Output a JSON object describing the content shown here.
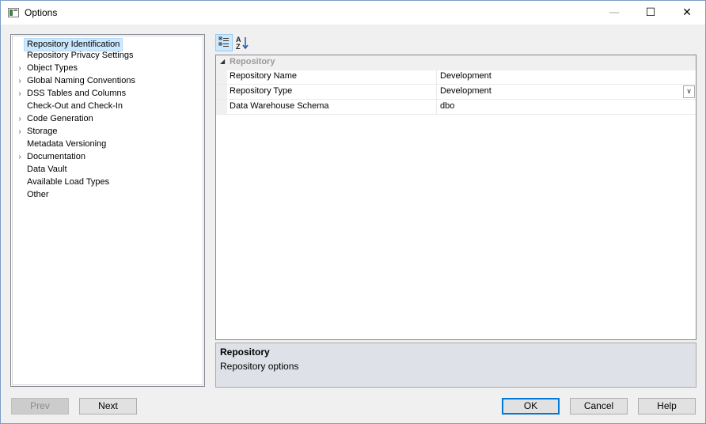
{
  "window": {
    "title": "Options",
    "minimize_glyph": "—",
    "maximize_glyph": "☐",
    "close_glyph": "✕"
  },
  "tree": {
    "items": [
      {
        "label": "Repository Identification",
        "expandable": false,
        "selected": true
      },
      {
        "label": "Repository Privacy Settings",
        "expandable": false
      },
      {
        "label": "Object Types",
        "expandable": true
      },
      {
        "label": "Global Naming Conventions",
        "expandable": true
      },
      {
        "label": "DSS Tables and Columns",
        "expandable": true
      },
      {
        "label": "Check-Out and Check-In",
        "expandable": false
      },
      {
        "label": "Code Generation",
        "expandable": true
      },
      {
        "label": "Storage",
        "expandable": true
      },
      {
        "label": "Metadata Versioning",
        "expandable": false
      },
      {
        "label": "Documentation",
        "expandable": true
      },
      {
        "label": "Data Vault",
        "expandable": false
      },
      {
        "label": "Available Load Types",
        "expandable": false
      },
      {
        "label": "Other",
        "expandable": false
      }
    ],
    "chevron_glyph": "›"
  },
  "toolbar": {
    "categorized_icon": "categorized-icon",
    "alphabetical_icon": "sort-alphabetical-icon"
  },
  "grid": {
    "category": {
      "label": "Repository",
      "toggle_glyph": "◢"
    },
    "properties": [
      {
        "name": "Repository Name",
        "value": "Development",
        "dropdown": false
      },
      {
        "name": "Repository Type",
        "value": "Development",
        "dropdown": true
      },
      {
        "name": "Data Warehouse Schema",
        "value": "dbo",
        "dropdown": false
      }
    ],
    "dropdown_glyph": "∨"
  },
  "description": {
    "title": "Repository",
    "text": "Repository options"
  },
  "buttons": {
    "prev": "Prev",
    "next": "Next",
    "ok": "OK",
    "cancel": "Cancel",
    "help": "Help"
  },
  "colors": {
    "selection": "#cce8ff",
    "accent": "#0078d7",
    "description_bg": "#dee1e7"
  }
}
